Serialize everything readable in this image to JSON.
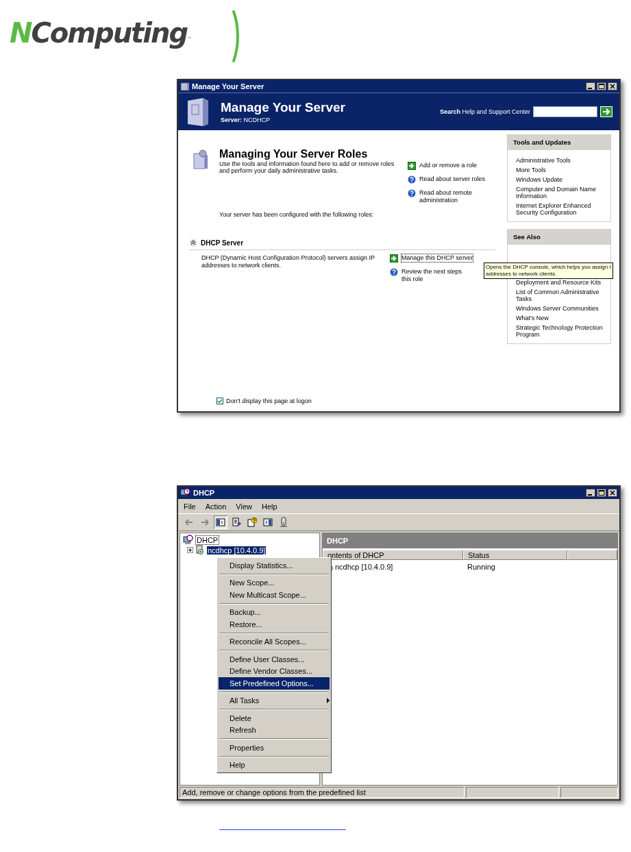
{
  "logo": {
    "wordmark": "NComputing",
    "trademark": "™"
  },
  "manage_window": {
    "title": "Manage Your Server",
    "header": {
      "title": "Manage Your Server",
      "server": "**Server:** NCDHCP",
      "search_label": "**Search** Help and Support Center"
    },
    "roles": {
      "heading": "Managing Your Server Roles",
      "intro": "Use the tools and information found here to add or remove roles and perform your daily administrative tasks.",
      "links": [
        {
          "kind": "go",
          "label": "Add or remove a role"
        },
        {
          "kind": "help",
          "label": "Read about server roles"
        },
        {
          "kind": "help",
          "label": "Read about remote administration"
        }
      ],
      "configured": "Your server has been configured with the following roles:"
    },
    "role": {
      "name": "DHCP Server",
      "expanded": true,
      "description": "DHCP (Dynamic Host Configuration Protocol) servers assign IP addresses to network clients.",
      "links": [
        {
          "kind": "go",
          "label": "Manage this DHCP server",
          "focused": true
        },
        {
          "kind": "help",
          "label": "Review the next steps\nthis role",
          "focused": false
        }
      ]
    },
    "sidebar": [
      {
        "title": "Tools and Updates",
        "items": [
          "Administrative Tools",
          "More Tools",
          "Windows Update",
          "Computer and Domain Name Information",
          "Internet Explorer Enhanced Security Configuration"
        ]
      },
      {
        "title": "See Also",
        "items": [
          "Deployment and Resource Kits",
          "List of Common Administrative Tasks",
          "Windows Server Communities",
          "What's New",
          "Strategic Technology Protection Program"
        ]
      }
    ],
    "tooltip": "Opens the DHCP console, which helps you assign I\naddresses to network clients.",
    "startup_option": {
      "label": "Don't display this page at logon",
      "checked": true
    }
  },
  "dhcp_window": {
    "title": "DHCP",
    "menu": [
      "File",
      "Action",
      "View",
      "Help"
    ],
    "toolbar": [
      {
        "kind": "back",
        "pressed": false
      },
      {
        "kind": "forward",
        "pressed": false
      },
      {
        "kind": "tree",
        "pressed": true
      },
      {
        "kind": "export",
        "pressed": false
      },
      {
        "kind": "help",
        "pressed": false
      },
      {
        "kind": "pane",
        "pressed": false
      },
      {
        "kind": "server",
        "pressed": false
      }
    ],
    "tree": [
      {
        "label": "DHCP",
        "selected": false,
        "children": [
          {
            "label": "ncdhcp [10.4.0.9]",
            "selected": true
          }
        ]
      }
    ],
    "pane_title": "DHCP",
    "columns": [
      "ontents of DHCP",
      "Status"
    ],
    "rows": [
      [
        "ncdhcp [10.4.0.9]",
        "Running"
      ]
    ],
    "context_menu": [
      {
        "kind": "item",
        "label": "Display Statistics...",
        "selected": false
      },
      {
        "kind": "separator"
      },
      {
        "kind": "item",
        "label": "New Scope...",
        "selected": false
      },
      {
        "kind": "item",
        "label": "New Multicast Scope...",
        "selected": false
      },
      {
        "kind": "separator"
      },
      {
        "kind": "item",
        "label": "Backup...",
        "selected": false
      },
      {
        "kind": "item",
        "label": "Restore...",
        "selected": false
      },
      {
        "kind": "separator"
      },
      {
        "kind": "item",
        "label": "Reconcile All Scopes...",
        "selected": false
      },
      {
        "kind": "separator"
      },
      {
        "kind": "item",
        "label": "Define User Classes...",
        "selected": false
      },
      {
        "kind": "item",
        "label": "Define Vendor Classes...",
        "selected": false
      },
      {
        "kind": "item",
        "label": "Set Predefined Options...",
        "selected": true
      },
      {
        "kind": "separator"
      },
      {
        "kind": "submenu",
        "label": "All Tasks",
        "selected": false
      },
      {
        "kind": "separator"
      },
      {
        "kind": "item",
        "label": "Delete",
        "selected": false
      },
      {
        "kind": "item",
        "label": "Refresh",
        "selected": false
      },
      {
        "kind": "separator"
      },
      {
        "kind": "item",
        "label": "Properties",
        "selected": false
      },
      {
        "kind": "separator"
      },
      {
        "kind": "item",
        "label": "Help",
        "selected": false
      }
    ],
    "status_bar": "Add, remove or change options from the predefined list"
  }
}
